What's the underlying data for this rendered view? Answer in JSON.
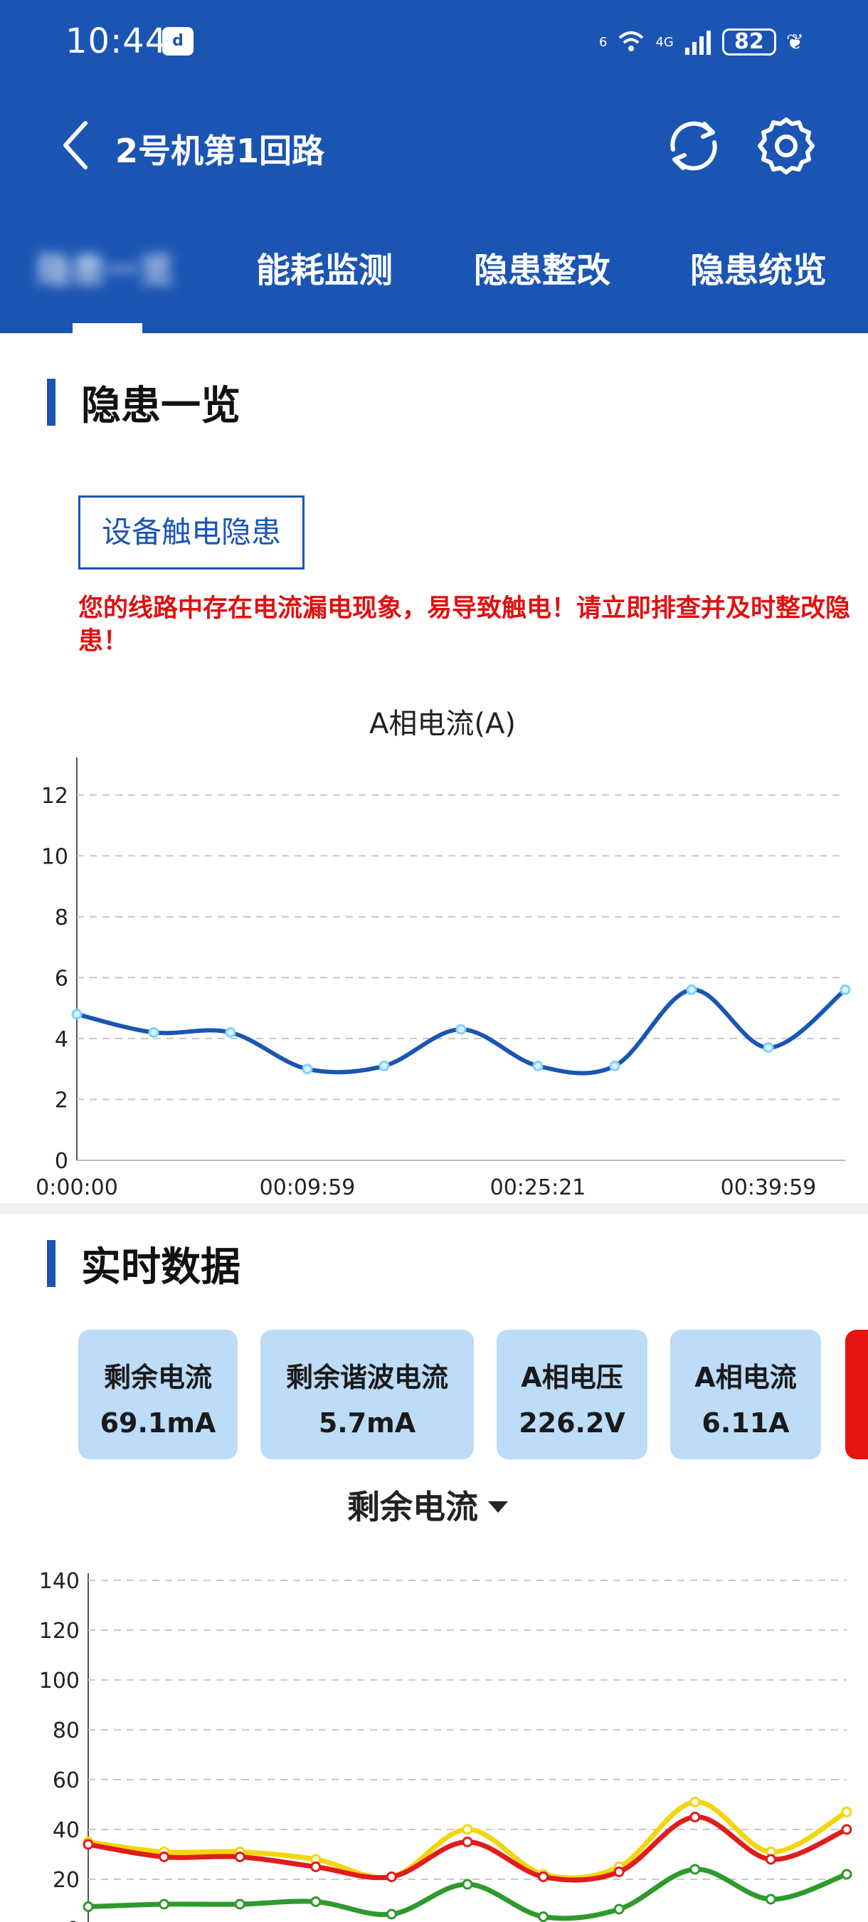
{
  "status_bar": {
    "time": "10:44",
    "app_icon": "app-notification-icon",
    "wifi_label": "6",
    "cell_label": "4G",
    "battery": "82"
  },
  "nav": {
    "title": "2号机第1回路",
    "icons": [
      "back-arrow-icon",
      "refresh-icon",
      "settings-gear-icon"
    ]
  },
  "tabs": [
    {
      "label": "隐患一览",
      "active": true,
      "blurred": true
    },
    {
      "label": "能耗监测"
    },
    {
      "label": "隐患整改"
    },
    {
      "label": "隐患统览"
    }
  ],
  "overview": {
    "section_title": "隐患一览",
    "hazard_tag": "设备触电隐患",
    "warning": "您的线路中存在电流漏电现象，易导致触电！请立即排查并及时整改隐患！"
  },
  "chart_data": [
    {
      "type": "line",
      "title": "A相电流(A)",
      "x": [
        "0:00:00",
        "",
        "",
        "00:09:59",
        "",
        "",
        "00:25:21",
        "",
        "",
        "00:39:59",
        ""
      ],
      "xticks": [
        "0:00:00",
        "00:09:59",
        "00:25:21",
        "00:39:59"
      ],
      "series": [
        {
          "color": "#1b55b3",
          "values": [
            4.8,
            4.2,
            4.2,
            3.0,
            3.1,
            4.3,
            3.1,
            3.1,
            5.6,
            3.7,
            5.6
          ]
        }
      ],
      "ylim": [
        0,
        13
      ],
      "yticks": [
        0,
        2,
        4,
        6,
        8,
        10,
        12
      ],
      "grid": true
    },
    {
      "type": "line",
      "title": "",
      "series": [
        {
          "color": "#f5d50c",
          "values": [
            35,
            31,
            31,
            28,
            21,
            40,
            22,
            25,
            51,
            31,
            47
          ]
        },
        {
          "color": "#e01c1c",
          "values": [
            34,
            29,
            29,
            25,
            21,
            35,
            21,
            23,
            45,
            28,
            40
          ]
        },
        {
          "color": "#2e9a2e",
          "values": [
            9,
            10,
            10,
            11,
            6,
            18,
            5,
            8,
            24,
            12,
            22
          ]
        }
      ],
      "ylim": [
        0,
        140
      ],
      "yticks": [
        0,
        20,
        40,
        60,
        80,
        100,
        120,
        140
      ],
      "grid": true
    }
  ],
  "realtime": {
    "section_title": "实时数据",
    "cards": [
      {
        "label": "剩余电流",
        "value": "69.1mA"
      },
      {
        "label": "剩余谐波电流",
        "value": "5.7mA"
      },
      {
        "label": "A相电压",
        "value": "226.2V"
      },
      {
        "label": "A相电流",
        "value": "6.11A"
      }
    ],
    "selector": "剩余电流",
    "colors": {
      "card_bg": "#bcdcf7",
      "accent": "#1b55b3",
      "alert": "#e01010"
    }
  }
}
